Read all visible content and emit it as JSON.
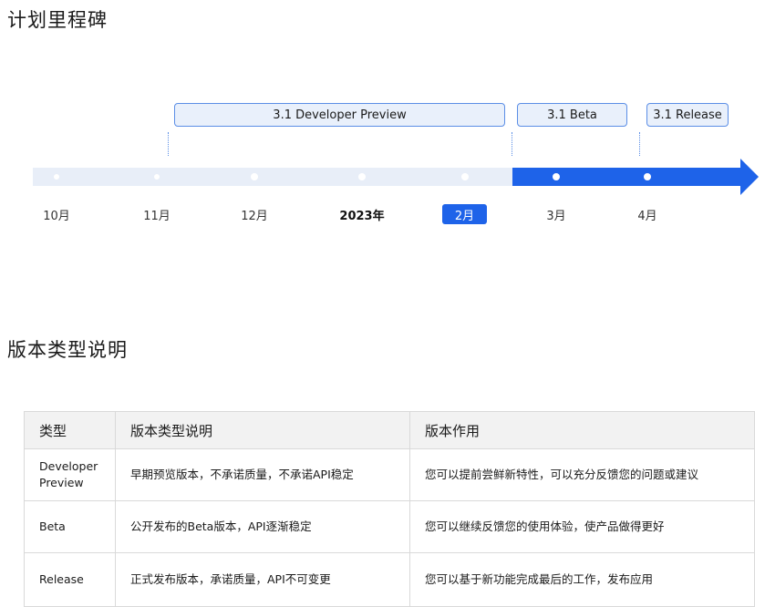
{
  "titles": {
    "milestones": "计划里程碑",
    "version_types": "版本类型说明"
  },
  "timeline": {
    "phases": [
      "3.1 Developer Preview",
      "3.1 Beta",
      "3.1 Release"
    ],
    "months": [
      "10月",
      "11月",
      "12月",
      "2023年",
      "2月",
      "3月",
      "4月"
    ],
    "current_month": "2月",
    "colors": {
      "past": "#e8eef8",
      "future": "#1e63e9",
      "phase_fill": "#e9f0fb",
      "phase_border": "#5b8ee6"
    }
  },
  "table": {
    "headers": [
      "类型",
      "版本类型说明",
      "版本作用"
    ],
    "rows": [
      [
        "Developer Preview",
        "早期预览版本，不承诺质量，不承诺API稳定",
        "您可以提前尝鲜新特性，可以充分反馈您的问题或建议"
      ],
      [
        "Beta",
        "公开发布的Beta版本，API逐渐稳定",
        "您可以继续反馈您的使用体验，使产品做得更好"
      ],
      [
        "Release",
        "正式发布版本，承诺质量，API不可变更",
        "您可以基于新功能完成最后的工作，发布应用"
      ]
    ]
  }
}
